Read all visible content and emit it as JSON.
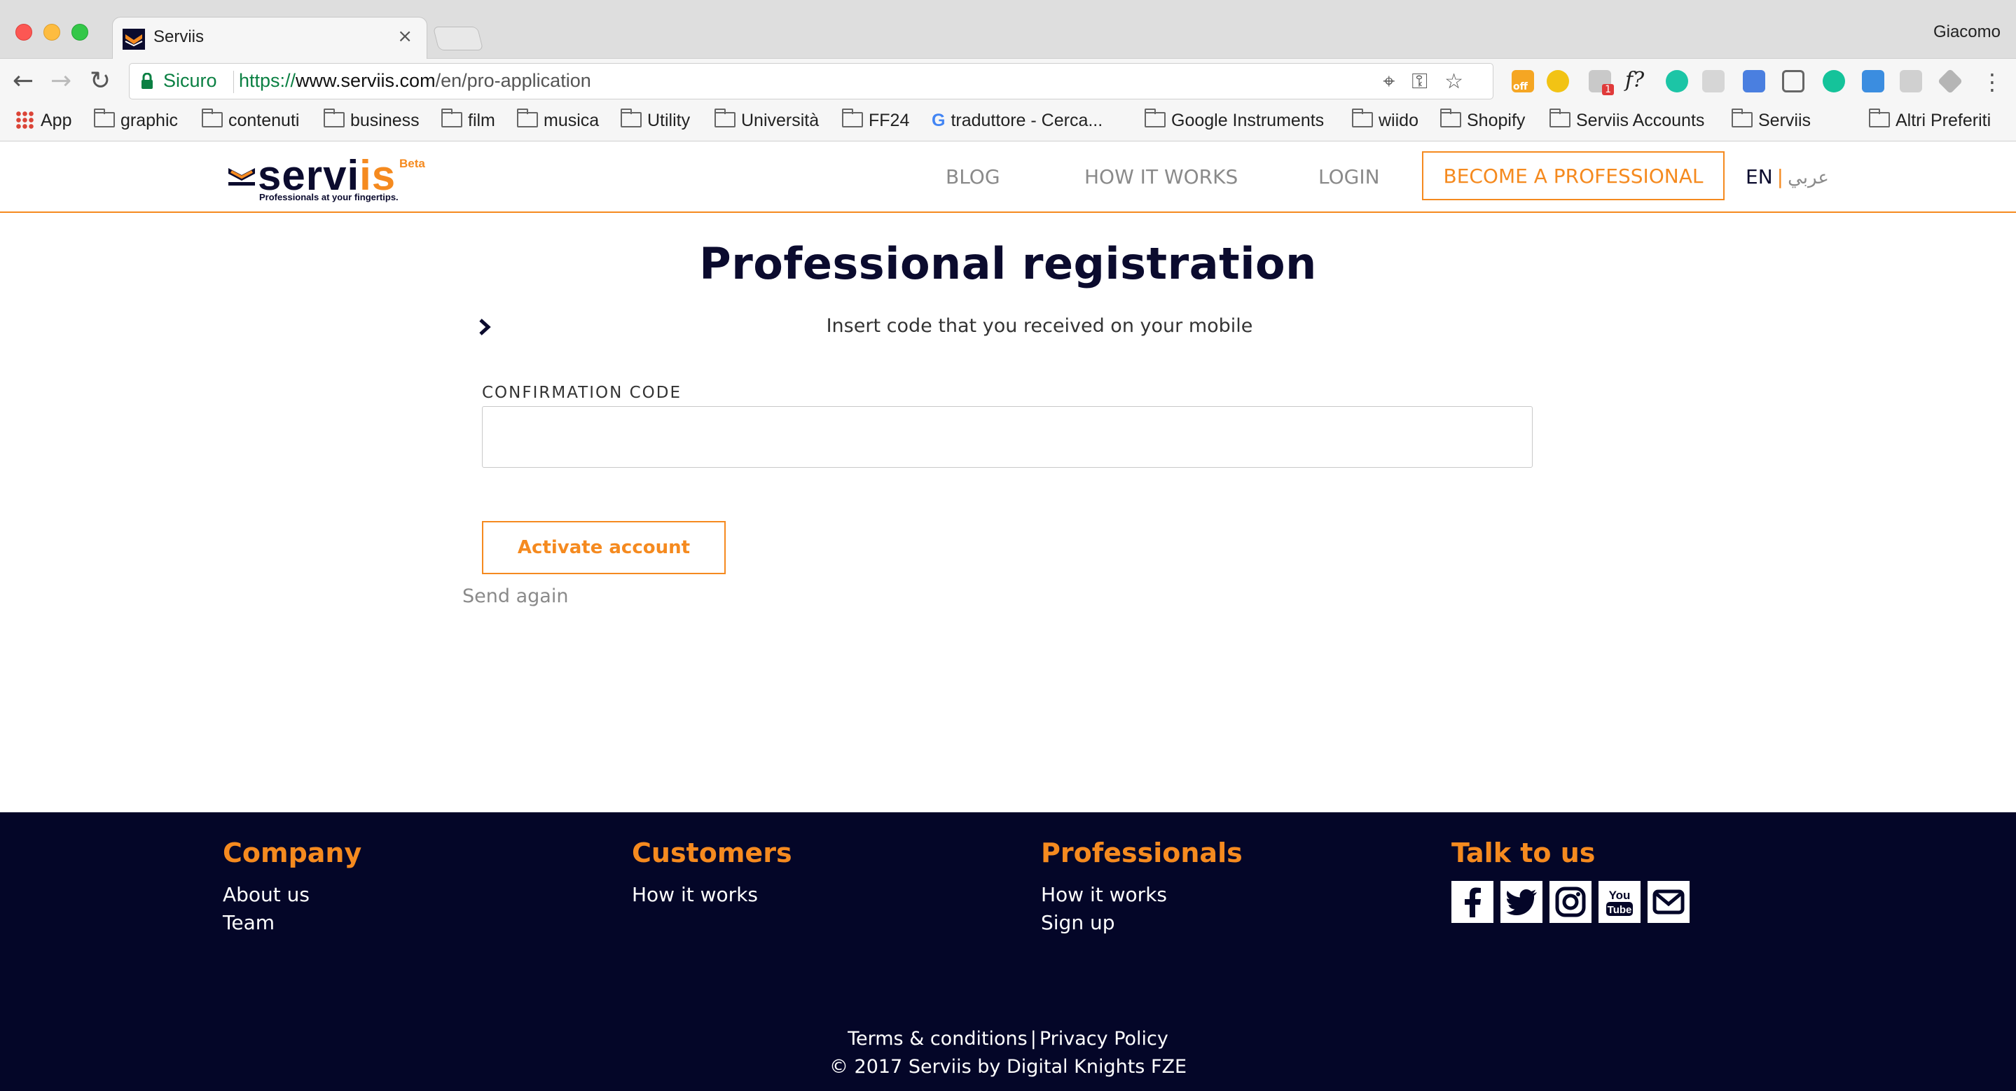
{
  "browser": {
    "tab_title": "Serviis",
    "tab_close": "×",
    "user_name": "Giacomo",
    "secure_label": "Sicuro",
    "url_protocol": "https://",
    "url_host": "www.serviis.com",
    "url_path": "/en/pro-application",
    "bookmarks": [
      {
        "label": "App",
        "type": "apps"
      },
      {
        "label": "graphic",
        "type": "folder"
      },
      {
        "label": "contenuti",
        "type": "folder"
      },
      {
        "label": "business",
        "type": "folder"
      },
      {
        "label": "film",
        "type": "folder"
      },
      {
        "label": "musica",
        "type": "folder"
      },
      {
        "label": "Utility",
        "type": "folder"
      },
      {
        "label": "Università",
        "type": "folder"
      },
      {
        "label": "FF24",
        "type": "folder"
      },
      {
        "label": "traduttore - Cerca...",
        "type": "google"
      },
      {
        "label": "Google Instruments",
        "type": "folder"
      },
      {
        "label": "wiido",
        "type": "folder"
      },
      {
        "label": "Shopify",
        "type": "folder"
      },
      {
        "label": "Serviis Accounts",
        "type": "folder"
      },
      {
        "label": "Serviis",
        "type": "folder"
      },
      {
        "label": "Altri Preferiti",
        "type": "folder"
      }
    ],
    "extension_badge_off": "off",
    "extension_badge_count": "1",
    "extension_fx": "f?"
  },
  "site": {
    "logo_word_left": "servi",
    "logo_word_right": "is",
    "logo_beta": "Beta",
    "logo_tagline": "Professionals at your fingertips.",
    "nav": {
      "blog": "BLOG",
      "how_it_works": "HOW IT WORKS",
      "login": "LOGIN",
      "become_professional": "BECOME A PROFESSIONAL",
      "lang_en": "EN",
      "lang_sep": "|",
      "lang_ar": "عربي"
    }
  },
  "main": {
    "title": "Professional registration",
    "subtitle": "Insert code that you received on your mobile",
    "field_label": "CONFIRMATION CODE",
    "field_value": "",
    "activate_label": "Activate account",
    "send_again": "Send again"
  },
  "footer": {
    "company": {
      "heading": "Company",
      "links": [
        "About us",
        "Team"
      ]
    },
    "customers": {
      "heading": "Customers",
      "links": [
        "How it works"
      ]
    },
    "professionals": {
      "heading": "Professionals",
      "links": [
        "How it works",
        "Sign up"
      ]
    },
    "talk": {
      "heading": "Talk to us",
      "social": [
        "facebook-icon",
        "twitter-icon",
        "instagram-icon",
        "youtube-icon",
        "mail-icon"
      ]
    },
    "terms": "Terms & conditions",
    "separator": "|",
    "privacy": "Privacy Policy",
    "copyright": "© 2017 Serviis by Digital Knights FZE"
  },
  "colors": {
    "accent": "#f58a1f",
    "navy": "#040628",
    "nav_gray": "#8a8a8a"
  }
}
